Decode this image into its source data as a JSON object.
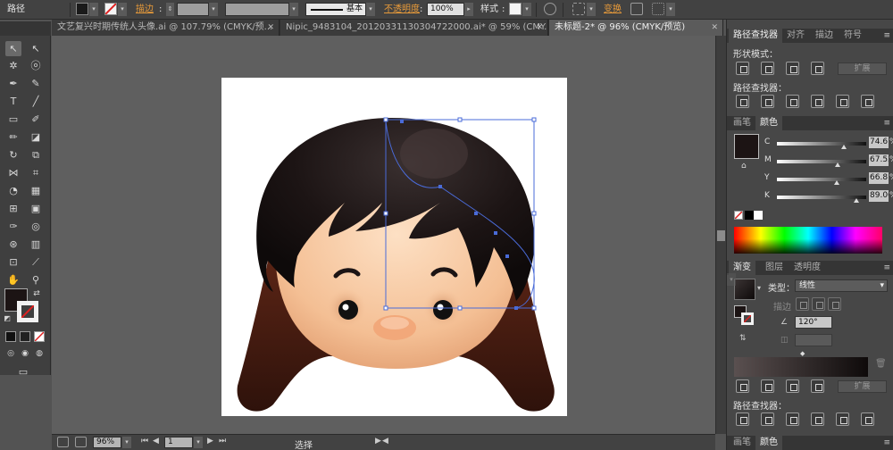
{
  "control_bar": {
    "object_type": "路径",
    "stroke_label": "描边",
    "stroke_profile": "基本",
    "opacity_label": "不透明度",
    "opacity_value": "100%",
    "style_label": "样式",
    "transform_label": "变换"
  },
  "tabs": [
    {
      "label": "文艺复兴时期传统人头像.ai @ 107.79% (CMYK/预..."
    },
    {
      "label": "Nipic_9483104_20120331130304722000.ai* @ 59% (CMY..."
    },
    {
      "label": "未标题-2* @ 96% (CMYK/预览)"
    }
  ],
  "status_bar": {
    "zoom": "96%",
    "artboard_num": "1",
    "tool": "选择"
  },
  "pathfinder": {
    "tabs": [
      "路径查找器",
      "对齐",
      "描边",
      "符号"
    ],
    "shape_modes_label": "形状模式：",
    "pathfinders_label": "路径查找器：",
    "expand_label": "扩展"
  },
  "color_panel": {
    "tabs": [
      "画笔",
      "颜色"
    ],
    "channels": [
      {
        "label": "C",
        "value": "74.61",
        "fraction": 0.75
      },
      {
        "label": "M",
        "value": "67.53",
        "fraction": 0.68
      },
      {
        "label": "Y",
        "value": "66.8",
        "fraction": 0.67
      },
      {
        "label": "K",
        "value": "89.06",
        "fraction": 0.89
      }
    ],
    "percent": "%"
  },
  "gradient_panel": {
    "tabs": [
      "渐变",
      "图层",
      "透明度"
    ],
    "type_label": "类型：",
    "type_value": "线性",
    "stroke_label": "描边",
    "angle_value": "120°"
  },
  "pathfinder2": {
    "expand_label": "扩展",
    "pathfinders_label": "路径查找器："
  },
  "bottom_tabs": [
    "画笔",
    "颜色"
  ],
  "colors": {
    "hair": "#1c1414",
    "skin": "#f6c49b",
    "back_hair": "#3e1a10",
    "selection": "#4a6bd8"
  }
}
